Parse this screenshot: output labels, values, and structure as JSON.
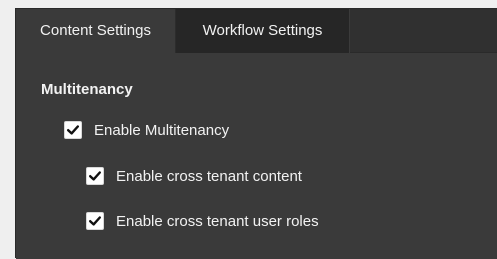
{
  "tabs": [
    {
      "label": "Content Settings",
      "active": true
    },
    {
      "label": "Workflow Settings",
      "active": false
    }
  ],
  "section": {
    "title": "Multitenancy"
  },
  "options": [
    {
      "label": "Enable Multitenancy",
      "checked": true
    },
    {
      "label": "Enable cross tenant content",
      "checked": true
    },
    {
      "label": "Enable cross tenant user roles",
      "checked": true
    }
  ],
  "colors": {
    "panel_background": "#3a3a3a",
    "tabbar_background": "#303030",
    "inactive_tab_background": "#262626",
    "text": "#f2f2f2",
    "checkbox_fill": "#ffffff",
    "checkmark": "#111111"
  },
  "icons": {
    "checkbox": "checkmark-icon"
  }
}
